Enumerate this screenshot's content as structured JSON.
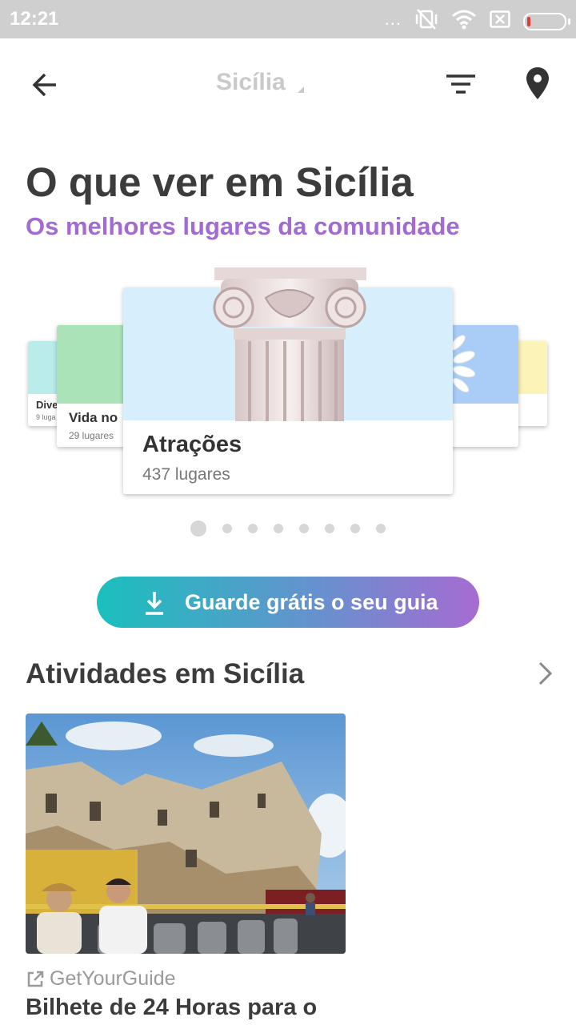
{
  "status_bar": {
    "time": "12:21",
    "more_dots": "..."
  },
  "header": {
    "place_title": "Sicília"
  },
  "page": {
    "heading": "O que ver em Sicília",
    "subheading": "Os melhores lugares da comunidade"
  },
  "carousel": {
    "cards": [
      {
        "label": "Dive",
        "count": "9 luga",
        "color": "#b9eceb"
      },
      {
        "label": "Vida no",
        "count": "29 lugares",
        "color": "#abe3b8"
      },
      {
        "label": "Atrações",
        "count": "437 lugares",
        "color": "#d7eefc"
      },
      {
        "label": "",
        "count": "",
        "color": "#a9cdf6"
      },
      {
        "label": "",
        "count": "",
        "color": "#fbf3b8"
      }
    ],
    "active_index": 0,
    "page_count": 8
  },
  "cta": {
    "label": "Guarde grátis o seu guia"
  },
  "activities": {
    "section_title": "Atividades em Sicília",
    "provider": "GetYourGuide",
    "title": "Bilhete de 24 Horas para o"
  }
}
